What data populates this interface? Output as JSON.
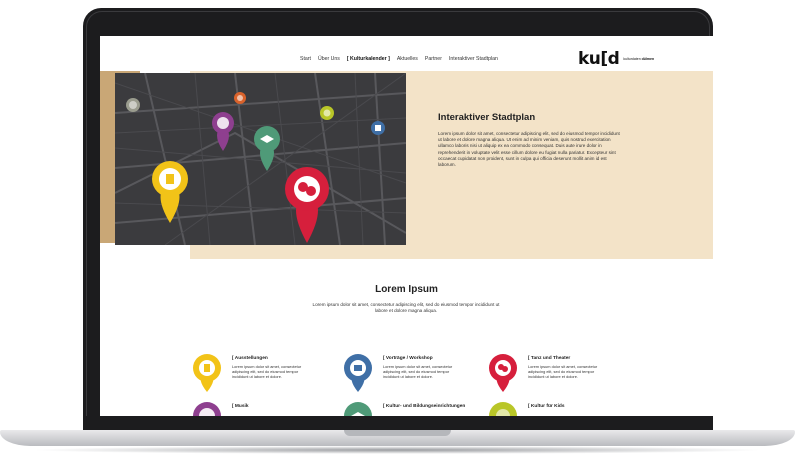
{
  "nav": {
    "items": [
      {
        "label": "Start"
      },
      {
        "label": "Über Uns"
      },
      {
        "label": "[ Kulturkalender ]"
      },
      {
        "label": "Aktuelles"
      },
      {
        "label": "Partner"
      },
      {
        "label": "Interaktiver Stadtplan"
      }
    ],
    "active_index": 2
  },
  "logo": {
    "mark": "ku[d",
    "sub_prefix": "kulturdaten ",
    "sub_bold": "dülmen"
  },
  "hero": {
    "title": "Interaktiver Stadtplan",
    "text": "Lorem ipsum dolor sit amet, consectetur adipiscing elit, sed do eiusmod tempor incididunt ut labore et dolore magna aliqua. Ut enim ad minim veniam, quis nostrud exercitation ullamco laboris nisi ut aliquip ex ea commodo consequat. Duis aute irure dolor in reprehenderit in voluptate velit esse cillum dolore eu fugiat nulla pariatur. Excepteur sint occaecat cupidatat non proident, sunt in culpa qui officia deserunt mollit anim id est laborum."
  },
  "section": {
    "title": "Lorem Ipsum",
    "text": "Lorem ipsum dolor sit amet, consectetur adipiscing elit, sed do eiusmod tempor incididunt ut labore et dolore magna aliqua."
  },
  "categories": [
    {
      "title": "[ Ausstellungen",
      "text": "Lorem ipsum dolor sit amet, consectetur adipiscing elit, sed do eiusmod tempor incididunt ut labore et dolore.",
      "color": "#f2c318",
      "icon": "chess-rook-icon"
    },
    {
      "title": "[ Vorträge / Workshop",
      "text": "Lorem ipsum dolor sit amet, consectetur adipiscing elit, sed do eiusmod tempor incididunt ut labore et dolore.",
      "color": "#3f6fa6",
      "icon": "building-icon"
    },
    {
      "title": "[ Tanz und Theater",
      "text": "Lorem ipsum dolor sit amet, consectetur adipiscing elit, sed do eiusmod tempor incididunt ut labore et dolore.",
      "color": "#d61f3c",
      "icon": "theater-masks-icon"
    },
    {
      "title": "[ Musik",
      "text": "",
      "color": "#8e3f8f",
      "icon": "guitar-icon"
    },
    {
      "title": "[ Kultur- und Bildungseinrichtungen",
      "text": "",
      "color": "#4f9a78",
      "icon": "graduation-cap-icon"
    },
    {
      "title": "[ Kultur für Kids",
      "text": "",
      "color": "#b9c628",
      "icon": "kids-icon"
    }
  ],
  "colors": {
    "beige": "#f3e3c8",
    "tan": "#c9a776",
    "map_bg": "#3b3b3e"
  }
}
